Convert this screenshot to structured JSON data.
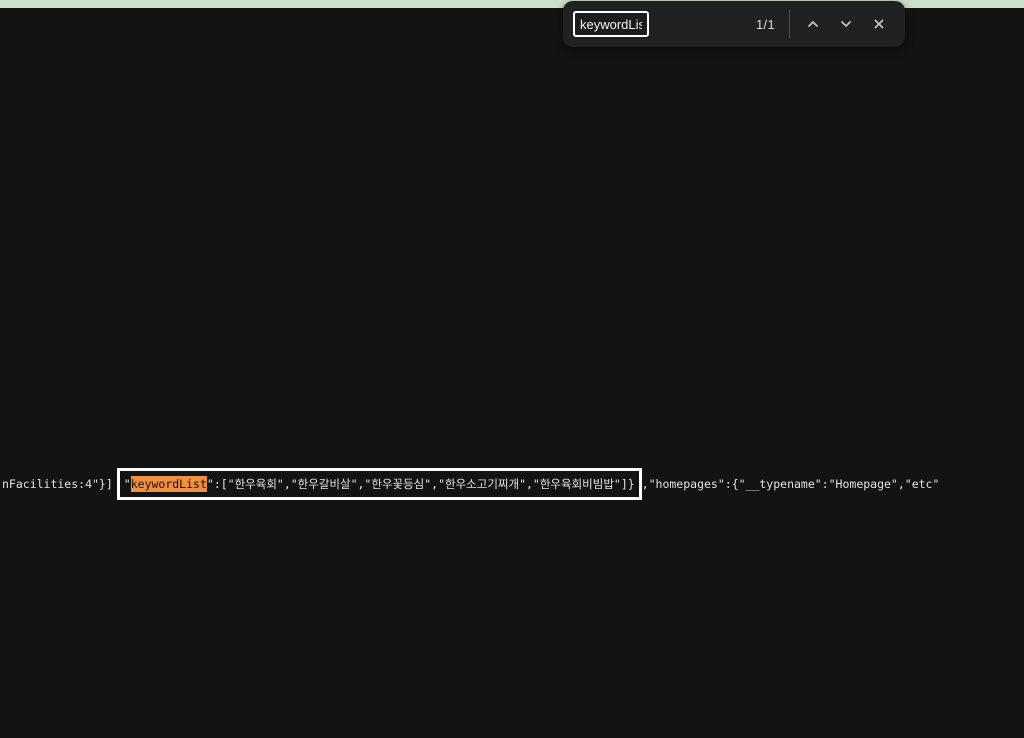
{
  "colors": {
    "page_background": "#131313",
    "top_banner_green": "#cde1c9",
    "findbar_background": "#202222",
    "findbar_text": "#f1f3f4",
    "icon_gray": "#bfc3c7",
    "code_text": "#e2e2e2",
    "match_highlight_orange": "#ef8f3f",
    "annotation_border_white": "#ffffff"
  },
  "findbar": {
    "query": "keywordList",
    "match_count": "1/1",
    "icons": {
      "previous": "chevron-up",
      "next": "chevron-down",
      "close": "x"
    }
  },
  "content": {
    "line": {
      "before_box": "nFacilities:4\"}]",
      "box_open_quote": "\"",
      "highlighted_term": "keywordList",
      "box_rest": "\":[\"한우육회\",\"한우갈비살\",\"한우꽃등심\",\"한우소고기찌개\",\"한우육회비빔밥\"]}",
      "after_box": ",\"homepages\":{\"__typename\":\"Homepage\",\"etc\""
    }
  }
}
